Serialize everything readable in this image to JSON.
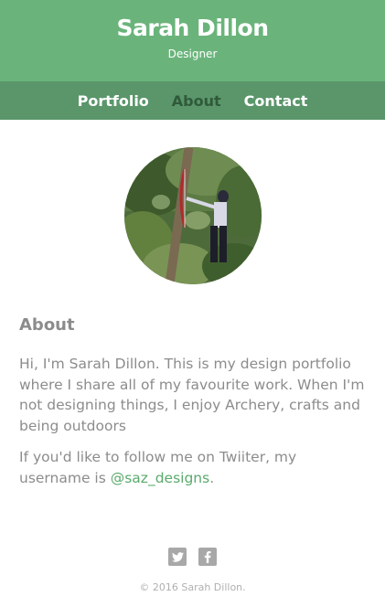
{
  "header": {
    "title": "Sarah Dillon",
    "subtitle": "Designer",
    "bg_color": "#6ab47b"
  },
  "nav": {
    "items": [
      {
        "label": "Portfolio",
        "active": false
      },
      {
        "label": "About",
        "active": true
      },
      {
        "label": "Contact",
        "active": false
      }
    ],
    "bg_color": "#5a966a"
  },
  "profile": {
    "image": "archery-photo"
  },
  "about": {
    "heading": "About",
    "paragraph1": "Hi, I'm Sarah Dillon. This is my design portfolio where I share all of my favourite work. When I'm not designing things, I enjoy Archery, crafts and being outdoors",
    "paragraph2_prefix": "If you'd like to follow me on Twiiter, my username is ",
    "paragraph2_link": "@saz_designs",
    "paragraph2_suffix": "."
  },
  "social": {
    "icons": [
      "twitter-icon",
      "facebook-icon"
    ]
  },
  "footer": {
    "copyright": "© 2016 Sarah Dillon."
  }
}
